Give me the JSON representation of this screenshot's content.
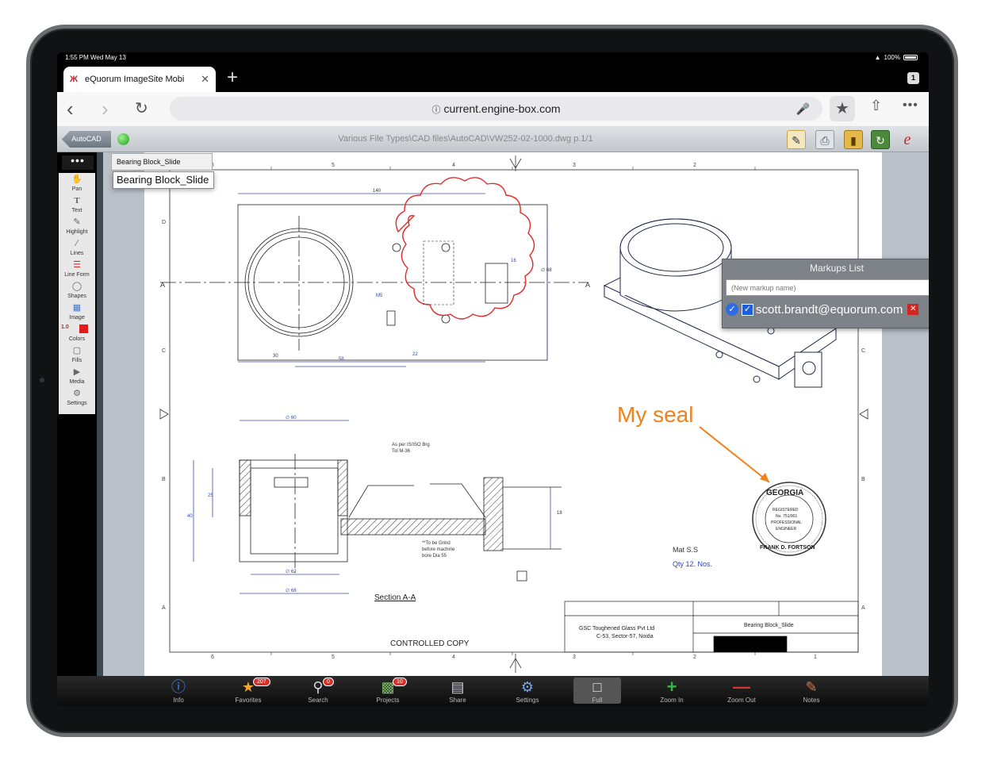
{
  "status_bar": {
    "time": "1:55 PM  Wed May 13",
    "battery": "100%"
  },
  "browser": {
    "tab_title": "eQuorum ImageSite Mobi",
    "tab_count": "1",
    "url": "current.engine-box.com"
  },
  "app_toolbar": {
    "back_label": "AutoCAD",
    "file_path": "Various File Types\\CAD files\\AutoCAD\\VW252-02-1000.dwg p.1/1"
  },
  "left_tools": [
    {
      "label": "Pan",
      "icon": "hand-icon"
    },
    {
      "label": "Text",
      "icon": "text-icon"
    },
    {
      "label": "Highlight",
      "icon": "highlighter-icon"
    },
    {
      "label": "Lines",
      "icon": "line-icon"
    },
    {
      "label": "Line Form",
      "icon": "line-form-icon"
    },
    {
      "label": "Shapes",
      "icon": "shapes-icon"
    },
    {
      "label": "Image",
      "icon": "image-icon"
    },
    {
      "label": "Colors",
      "icon": "colors-icon"
    },
    {
      "label": "Fills",
      "icon": "fills-icon"
    },
    {
      "label": "Media",
      "icon": "media-icon"
    },
    {
      "label": "Settings",
      "icon": "settings-icon"
    }
  ],
  "colors": {
    "line_size": "1.0",
    "swatch": "#e01b1b",
    "accent": "#2e6be6"
  },
  "layer": {
    "strip_label": "Bearing Block_Slide",
    "popup_label": "Bearing Block_Slide"
  },
  "markups": {
    "title": "Markups List",
    "placeholder": "(New markup name)",
    "entry": "scott.brandt@equorum.com"
  },
  "drawing": {
    "annotation": "My seal",
    "section_label": "Section A-A",
    "controlled_copy": "CONTROLLED COPY",
    "mat": "Mat S.S",
    "qty": "Qty 12. Nos.",
    "company_line1": "GSC Toughened Glass Pvt Ltd",
    "company_line2": "C-53, Sector-57, Noida",
    "title_block_name": "Bearing Block_Slide",
    "seal_top": "GEORGIA",
    "seal_mid1": "REGISTERED",
    "seal_mid2": "No. 751/901",
    "seal_mid3": "PROFESSIONAL",
    "seal_mid4": "ENGINEER",
    "seal_bottom": "FRANK D. FORTSON",
    "dim_140": "140",
    "dim_60": "∅ 60",
    "dim_62": "∅ 62",
    "dim_68": "∅ 68",
    "dim_40": "40",
    "dim_25": "25",
    "dim_18": "18",
    "dim_m5": "M5",
    "dim_22": "22",
    "dim_16": "16",
    "dim_30": "30",
    "dim_58": "58",
    "note1": "As per IS/ISO Brg",
    "note2": "Tol M-36",
    "note3": "**To be Grind",
    "note4": "before machine",
    "note5": "bore Dia 55",
    "row_a": "A",
    "row_b": "B",
    "row_c": "C",
    "row_d": "D",
    "cols": [
      "6",
      "5",
      "4",
      "3",
      "2",
      "1"
    ]
  },
  "bottom_bar": [
    {
      "label": "Info",
      "icon": "info-icon",
      "badge": ""
    },
    {
      "label": "Favorites",
      "icon": "star-icon",
      "badge": "207"
    },
    {
      "label": "Search",
      "icon": "search-icon",
      "badge": "0"
    },
    {
      "label": "Projects",
      "icon": "projects-icon",
      "badge": "10"
    },
    {
      "label": "Share",
      "icon": "share-doc-icon",
      "badge": ""
    },
    {
      "label": "Settings",
      "icon": "gear-icon",
      "badge": ""
    },
    {
      "label": "Full",
      "icon": "page-icon",
      "badge": ""
    },
    {
      "label": "Zoom In",
      "icon": "zoom-in-icon",
      "badge": ""
    },
    {
      "label": "Zoom Out",
      "icon": "zoom-out-icon",
      "badge": ""
    },
    {
      "label": "Notes",
      "icon": "notes-icon",
      "badge": ""
    }
  ]
}
